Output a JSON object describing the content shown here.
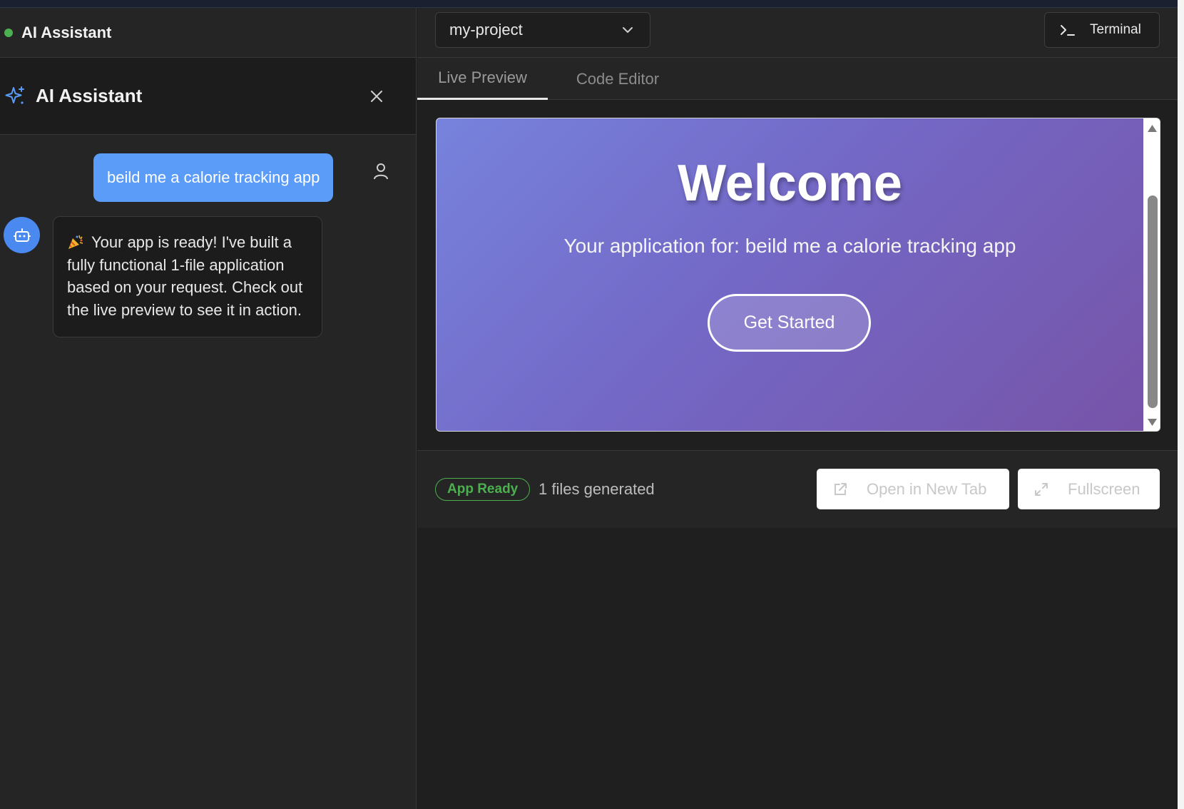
{
  "left_header": {
    "title": "AI Assistant",
    "status_color": "#4caf50"
  },
  "assistant": {
    "title": "AI Assistant"
  },
  "messages": {
    "user": "beild me a calorie tracking app",
    "bot": "Your app is ready! I've built a fully functional 1-file application based on your request. Check out the live preview to see it in action."
  },
  "toolbar": {
    "project": "my-project",
    "terminal_label": "Terminal"
  },
  "tabs": [
    {
      "label": "Live Preview",
      "active": true
    },
    {
      "label": "Code Editor",
      "active": false
    }
  ],
  "preview": {
    "heading": "Welcome",
    "subtitle": "Your application for: beild me a calorie tracking app",
    "cta": "Get Started"
  },
  "footer": {
    "status_badge": "App Ready",
    "files": "1 files generated",
    "open_new_tab": "Open in New Tab",
    "fullscreen": "Fullscreen"
  },
  "colors": {
    "accent": "#5a9cf8",
    "success": "#4caf50",
    "gradient_start": "#7683dc",
    "gradient_end": "#7654a8"
  }
}
